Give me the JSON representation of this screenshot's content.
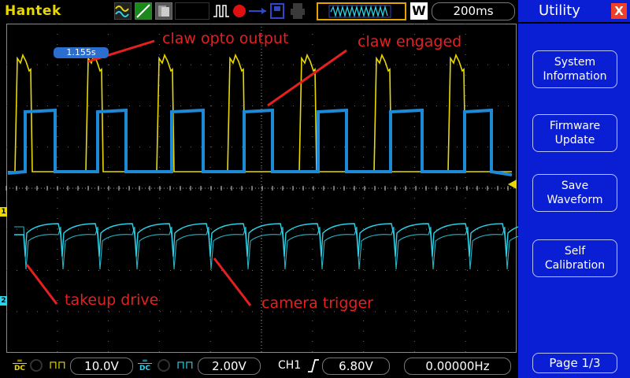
{
  "topbar": {
    "brand": "Hantek",
    "timebase": "200ms",
    "w_label": "W"
  },
  "screen": {
    "trigger_time": "1.155s",
    "ch1_marker": "1",
    "ch2_marker": "2"
  },
  "annotations": {
    "claw_opto_output": "claw opto output",
    "claw_engaged": "claw engaged",
    "takeup_drive": "takeup drive",
    "camera_trigger": "camera trigger"
  },
  "bottombar": {
    "ch1_coupling": "DC",
    "ch1_scale": "10.0V",
    "ch2_coupling": "DC",
    "ch2_scale": "2.00V",
    "trigger_source": "CH1",
    "trigger_level": "6.80V",
    "frequency": "0.00000Hz"
  },
  "panel": {
    "title": "Utility",
    "close": "X",
    "buttons": [
      {
        "line1": "System",
        "line2": "Information"
      },
      {
        "line1": "Firmware",
        "line2": "Update"
      },
      {
        "line1": "Save",
        "line2": "Waveform"
      },
      {
        "line1": "Self",
        "line2": "Calibration"
      }
    ],
    "page": "Page 1/3"
  },
  "colors": {
    "ch1": "#e8d800",
    "ch2": "#2ed2e8",
    "claw_overlay": "#1d8ad6",
    "annotation": "#e62020",
    "panel": "#0a1ed4"
  }
}
